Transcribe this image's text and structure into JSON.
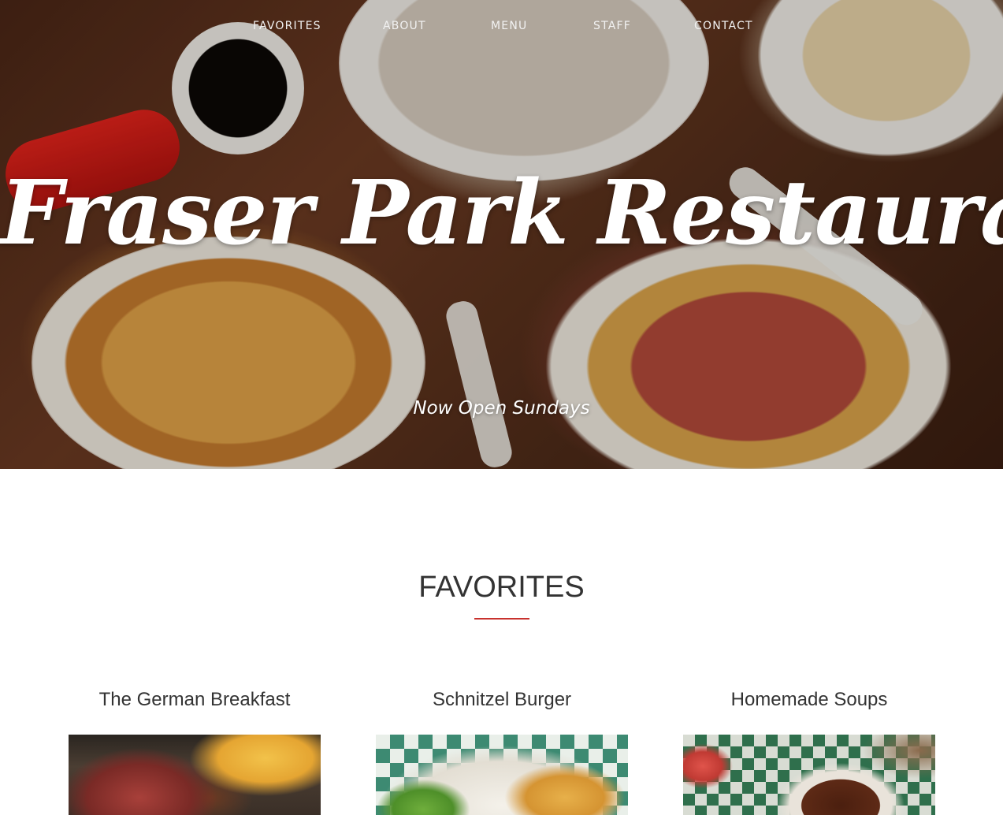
{
  "nav": {
    "items": [
      {
        "label": "FAVORITES"
      },
      {
        "label": "ABOUT"
      },
      {
        "label": "MENU"
      },
      {
        "label": "STAFF"
      },
      {
        "label": "CONTACT"
      }
    ]
  },
  "hero": {
    "title": "Fraser Park Restaurant",
    "subtitle": "Now Open Sundays"
  },
  "favorites": {
    "heading": "FAVORITES",
    "accent_color": "#c8322e",
    "cards": [
      {
        "title": "The German Breakfast"
      },
      {
        "title": "Schnitzel Burger"
      },
      {
        "title": "Homemade Soups"
      }
    ]
  }
}
